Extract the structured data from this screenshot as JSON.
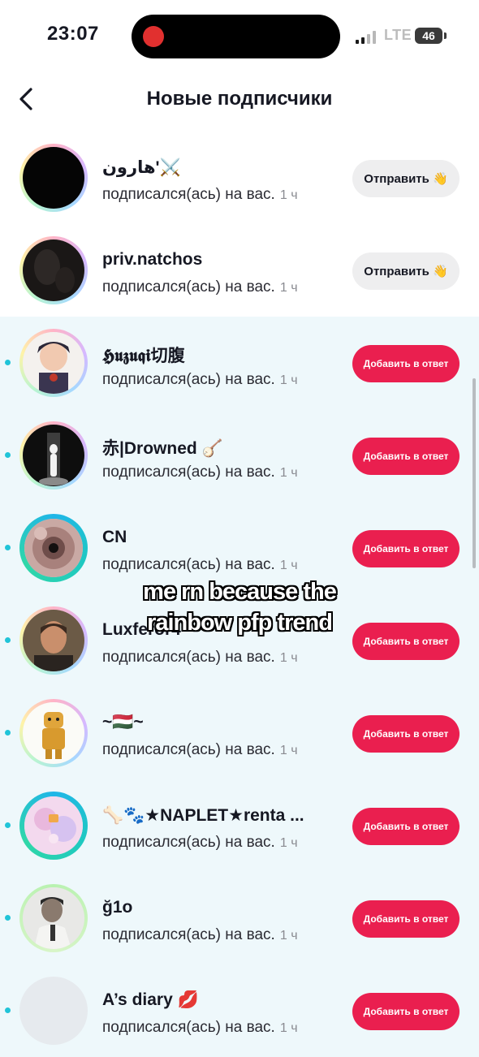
{
  "status": {
    "time": "23:07",
    "network": "LTE",
    "battery": "46"
  },
  "header": {
    "title": "Новые подписчики",
    "back_icon": "chevron-left-icon"
  },
  "colors": {
    "accent": "#ea1f4f",
    "unread_dot": "#20c4d8",
    "unread_bg": "#eef8fb"
  },
  "followers": [
    {
      "name": "هارون'⚔️",
      "subtitle": "подписался(ась) на вас.",
      "time": "1 ч",
      "action": "Отправить 👋",
      "action_type": "send",
      "unread": false,
      "avatar": "black"
    },
    {
      "name": "priv.natchos",
      "subtitle": "подписался(ась) на вас.",
      "time": "1 ч",
      "action": "Отправить 👋",
      "action_type": "send",
      "unread": false,
      "avatar": "dark"
    },
    {
      "name": "𝕳𝖚𝖟𝖚𝖖𝖎切腹",
      "subtitle": "подписался(ась) на вас.",
      "time": "1 ч",
      "action": "Добавить в ответ",
      "action_type": "add",
      "unread": true,
      "avatar": "anime"
    },
    {
      "name": "赤|Drowned 🪕",
      "subtitle": "подписался(ась) на вас.",
      "time": "1 ч",
      "action": "Добавить в ответ",
      "action_type": "add",
      "unread": true,
      "avatar": "silhouette"
    },
    {
      "name": "CN",
      "subtitle": "подписался(ась) на вас.",
      "time": "1 ч",
      "action": "Добавить в ответ",
      "action_type": "add",
      "unread": true,
      "avatar": "flower"
    },
    {
      "name": "Luxferor4",
      "subtitle": "подписался(ась) на вас.",
      "time": "1 ч",
      "action": "Добавить в ответ",
      "action_type": "add",
      "unread": true,
      "avatar": "man"
    },
    {
      "name": "~🇭🇺~",
      "subtitle": "подписался(ась) на вас.",
      "time": "1 ч",
      "action": "Добавить в ответ",
      "action_type": "add",
      "unread": true,
      "avatar": "lego"
    },
    {
      "name": "🦴🐾★NAPLET★renta ...",
      "subtitle": "подписался(ась) на вас.",
      "time": "1 ч",
      "action": "Добавить в ответ",
      "action_type": "add",
      "unread": true,
      "avatar": "pastel"
    },
    {
      "name": "ğ1o",
      "subtitle": "подписался(ась) на вас.",
      "time": "1 ч",
      "action": "Добавить в ответ",
      "action_type": "add",
      "unread": true,
      "avatar": "photo"
    },
    {
      "name": "A’s diary 💋",
      "subtitle": "подписался(ась) на вас.",
      "time": "1 ч",
      "action": "Добавить в ответ",
      "action_type": "add",
      "unread": true,
      "avatar": "blank"
    }
  ],
  "overlay": {
    "line1": "me rn because the",
    "line2": "rainbow pfp trend"
  }
}
